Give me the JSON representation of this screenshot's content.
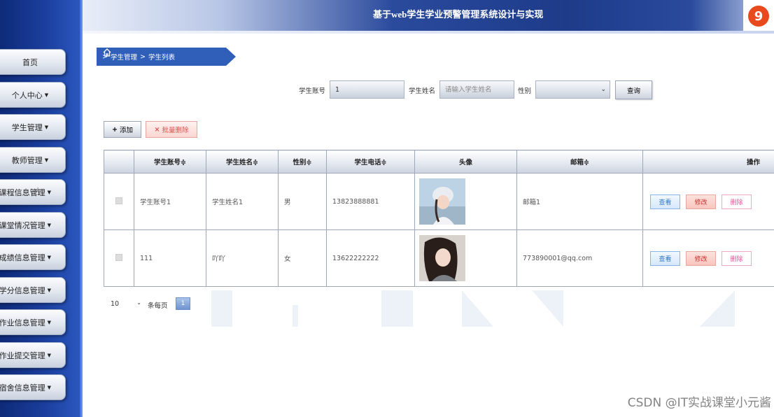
{
  "header": {
    "title": "基于web学生学业预警管理系统设计与实现"
  },
  "sidebar": {
    "items": [
      {
        "label": "首页",
        "dropdown": false
      },
      {
        "label": "个人中心",
        "dropdown": true
      },
      {
        "label": "学生管理",
        "dropdown": true
      },
      {
        "label": "教师管理",
        "dropdown": true
      },
      {
        "label": "课程信息管理",
        "dropdown": true
      },
      {
        "label": "课堂情况管理",
        "dropdown": true
      },
      {
        "label": "成绩信息管理",
        "dropdown": true
      },
      {
        "label": "学分信息管理",
        "dropdown": true
      },
      {
        "label": "作业信息管理",
        "dropdown": true
      },
      {
        "label": "作业提交管理",
        "dropdown": true
      },
      {
        "label": "宿舍信息管理",
        "dropdown": true
      }
    ]
  },
  "breadcrumb": {
    "sep": ">",
    "level1": "学生管理",
    "level2": "学生列表"
  },
  "search": {
    "account_label": "学生账号",
    "account_value": "1",
    "name_label": "学生姓名",
    "name_placeholder": "请输入学生姓名",
    "gender_label": "性别",
    "gender_value": "",
    "query_button": "查询"
  },
  "actions": {
    "add": "添加",
    "batch_delete": "批量删除"
  },
  "table": {
    "headers": {
      "account": "学生账号",
      "name": "学生姓名",
      "gender": "性别",
      "phone": "学生电话",
      "avatar": "头像",
      "email": "邮箱",
      "ops": "操作"
    },
    "sort_mark": "≑",
    "rows": [
      {
        "account": "学生账号1",
        "name": "学生姓名1",
        "gender": "男",
        "phone": "13823888881",
        "email": "邮箱1"
      },
      {
        "account": "111",
        "name": "吖吖",
        "gender": "女",
        "phone": "13622222222",
        "email": "773890001@qq.com"
      }
    ],
    "row_buttons": {
      "view": "查看",
      "edit": "修改",
      "delete": "删除"
    }
  },
  "pagination": {
    "page_size": "10",
    "per_page_label": "条每页",
    "current_page": "1"
  },
  "watermark": "CSDN @IT实战课堂小元酱",
  "colors": {
    "sidebar": "#1b3f9e",
    "breadcrumb": "#2f5fb8",
    "delete": "#d9534f",
    "view": "#3178c6"
  },
  "icons": {
    "home": "home-icon",
    "plus": "plus-icon",
    "times": "times-icon",
    "cursor": "hand-cursor-icon"
  }
}
